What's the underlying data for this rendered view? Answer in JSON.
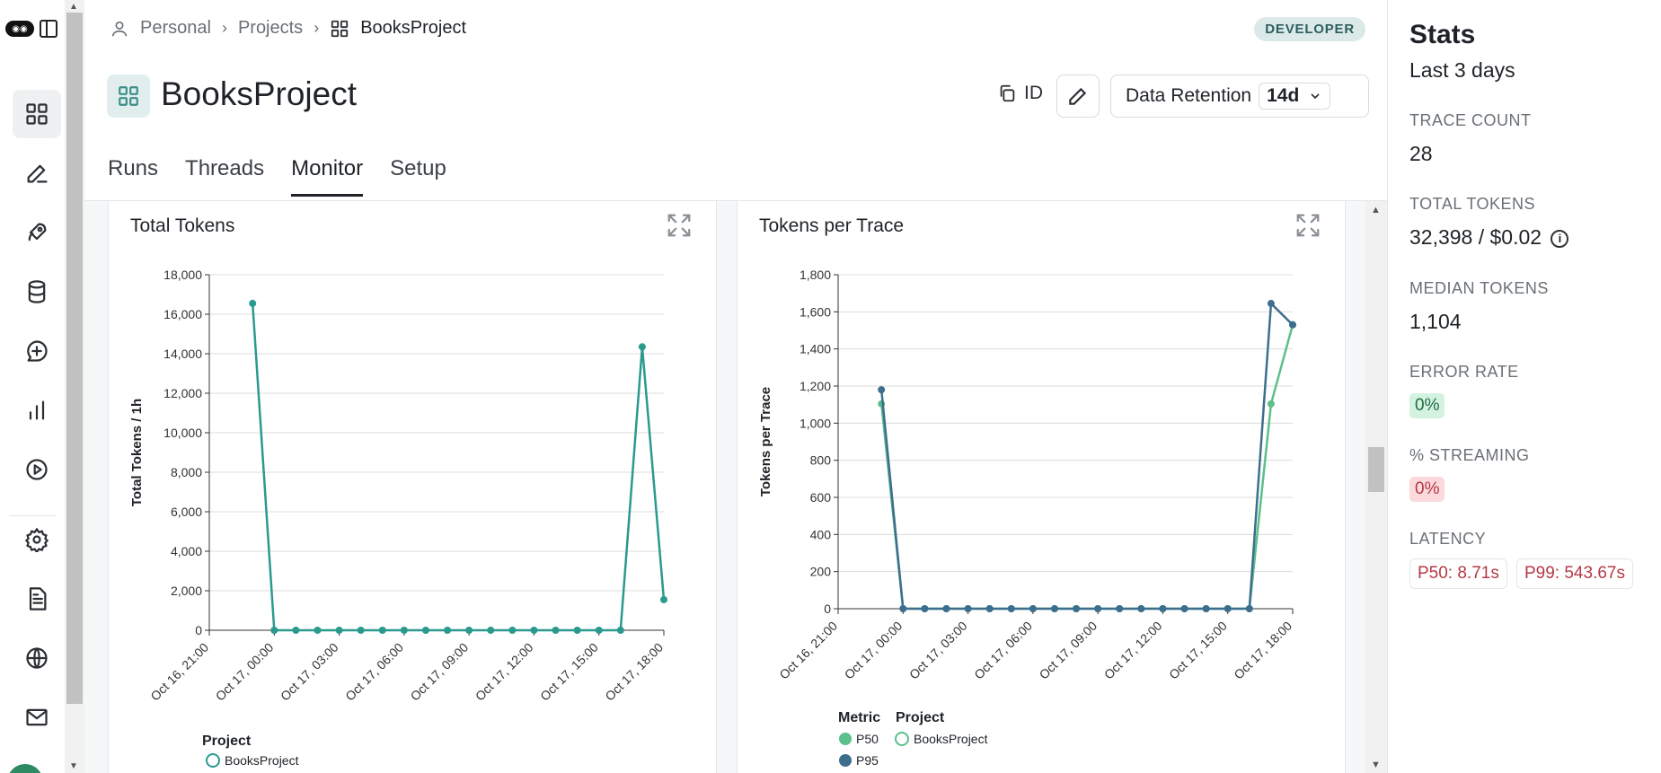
{
  "breadcrumb": {
    "personal": "Personal",
    "projects": "Projects",
    "current": "BooksProject"
  },
  "badge": "DEVELOPER",
  "project": {
    "title": "BooksProject"
  },
  "header": {
    "id_label": "ID",
    "retention_label": "Data Retention",
    "retention_value": "14d"
  },
  "tabs": [
    {
      "label": "Runs"
    },
    {
      "label": "Threads"
    },
    {
      "label": "Monitor"
    },
    {
      "label": "Setup"
    }
  ],
  "rail": {
    "icons": [
      "grid-icon",
      "pencil-icon",
      "rocket-icon",
      "database-icon",
      "chat-plus-icon",
      "bar-chart-icon",
      "play-icon",
      "gear-icon",
      "document-icon",
      "globe-icon",
      "mail-icon"
    ]
  },
  "stats": {
    "title": "Stats",
    "subtitle": "Last 3 days",
    "trace_count_label": "TRACE COUNT",
    "trace_count": "28",
    "total_tokens_label": "TOTAL TOKENS",
    "total_tokens": "32,398 / $0.02",
    "median_tokens_label": "MEDIAN TOKENS",
    "median_tokens": "1,104",
    "error_rate_label": "ERROR RATE",
    "error_rate": "0%",
    "streaming_label": "% STREAMING",
    "streaming": "0%",
    "latency_label": "LATENCY",
    "p50": "P50: 8.71s",
    "p99": "P99: 543.67s"
  },
  "colors": {
    "teal": "#2a9a8e",
    "p50": "#5cc08a",
    "p95": "#3d6e8e"
  },
  "chart_data": [
    {
      "type": "line",
      "title": "Total Tokens",
      "ylabel": "Total Tokens / 1h",
      "ylim": [
        0,
        18000
      ],
      "yticks": [
        "0",
        "2,000",
        "4,000",
        "6,000",
        "8,000",
        "10,000",
        "12,000",
        "14,000",
        "16,000",
        "18,000"
      ],
      "xticks": [
        "Oct 16, 21:00",
        "Oct 17, 00:00",
        "Oct 17, 03:00",
        "Oct 17, 06:00",
        "Oct 17, 09:00",
        "Oct 17, 12:00",
        "Oct 17, 15:00",
        "Oct 17, 18:00"
      ],
      "x_hours": [
        -1,
        0,
        1,
        2,
        3,
        4,
        5,
        6,
        7,
        8,
        9,
        10,
        11,
        12,
        13,
        14,
        15,
        16,
        17,
        18
      ],
      "series": [
        {
          "name": "BooksProject",
          "values": [
            16550,
            0,
            0,
            0,
            0,
            0,
            0,
            0,
            0,
            0,
            0,
            0,
            0,
            0,
            0,
            0,
            0,
            0,
            14350,
            1550
          ]
        }
      ],
      "legend": {
        "title": "Project",
        "items": [
          "BooksProject"
        ]
      },
      "grid": true
    },
    {
      "type": "line",
      "title": "Tokens per Trace",
      "ylabel": "Tokens per Trace",
      "ylim": [
        0,
        1800
      ],
      "yticks": [
        "0",
        "200",
        "400",
        "600",
        "800",
        "1,000",
        "1,200",
        "1,400",
        "1,600",
        "1,800"
      ],
      "xticks": [
        "Oct 16, 21:00",
        "Oct 17, 00:00",
        "Oct 17, 03:00",
        "Oct 17, 06:00",
        "Oct 17, 09:00",
        "Oct 17, 12:00",
        "Oct 17, 15:00",
        "Oct 17, 18:00"
      ],
      "x_hours": [
        -1,
        0,
        1,
        2,
        3,
        4,
        5,
        6,
        7,
        8,
        9,
        10,
        11,
        12,
        13,
        14,
        15,
        16,
        17,
        18
      ],
      "series": [
        {
          "name": "P50",
          "values": [
            1104,
            0,
            0,
            0,
            0,
            0,
            0,
            0,
            0,
            0,
            0,
            0,
            0,
            0,
            0,
            0,
            0,
            0,
            1104,
            1530
          ]
        },
        {
          "name": "P95",
          "values": [
            1180,
            0,
            0,
            0,
            0,
            0,
            0,
            0,
            0,
            0,
            0,
            0,
            0,
            0,
            0,
            0,
            0,
            0,
            1645,
            1530
          ]
        }
      ],
      "legend": {
        "metric_title": "Metric",
        "metric_items": [
          "P50",
          "P95"
        ],
        "project_title": "Project",
        "project_items": [
          "BooksProject"
        ]
      },
      "grid": true
    }
  ]
}
